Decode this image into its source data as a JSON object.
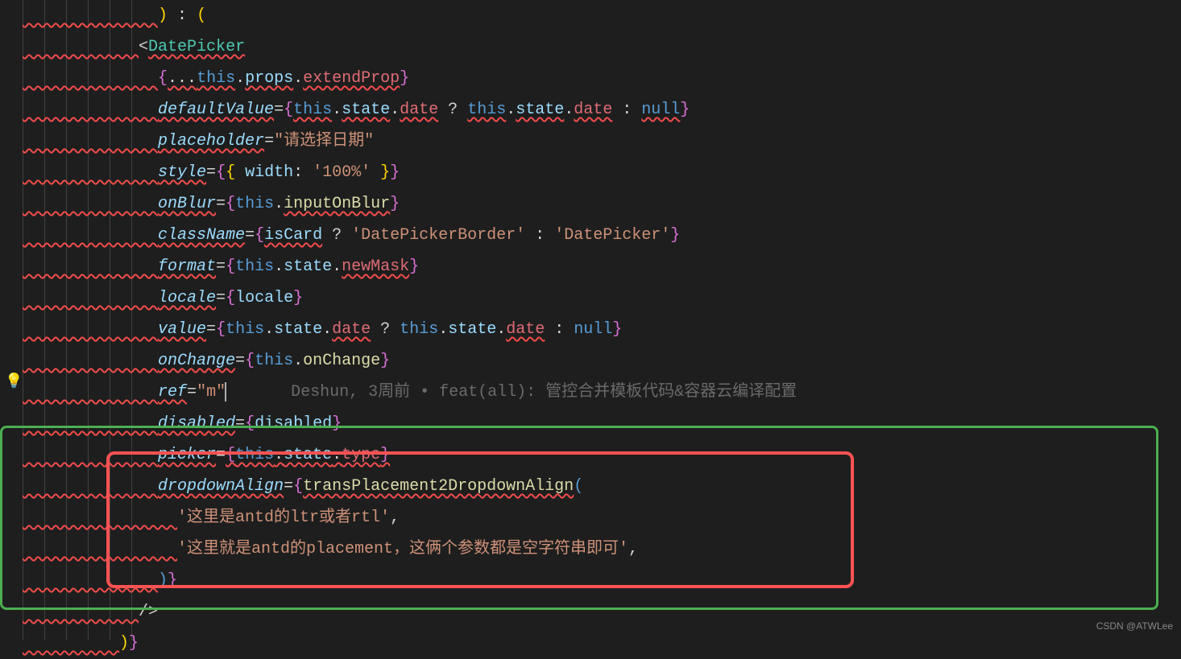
{
  "code": {
    "line0_indent": "              ",
    "line0_a": ")",
    "line0_b": " : ",
    "line0_c": "(",
    "line1_indent": "            ",
    "line1_open": "<",
    "line1_tag": "DatePicker",
    "prop_indent": "              ",
    "spread_open": "{",
    "spread_text": "...",
    "spread_this": "this",
    "spread_dot": ".",
    "spread_props": "props",
    "spread_extend": "extendProp",
    "spread_close": "}",
    "defaultValue": "defaultValue",
    "eq": "=",
    "this": "this",
    "dot": ".",
    "state": "state",
    "date": "date",
    "q": " ? ",
    "colon": " : ",
    "null": "null",
    "placeholder_attr": "placeholder",
    "placeholder_val": "\"请选择日期\"",
    "style_attr": "style",
    "style_open": "{{",
    "style_width": " width",
    "style_colon": ": ",
    "style_100": "'100%'",
    "style_close": " }}",
    "onBlur_attr": "onBlur",
    "onBlur_method": "inputOnBlur",
    "className_attr": "className",
    "isCard": "isCard",
    "dp_border": "'DatePickerBorder'",
    "dp": "'DatePicker'",
    "format_attr": "format",
    "newMask": "newMask",
    "locale_attr": "locale",
    "locale_val": "locale",
    "value_attr": "value",
    "onChange_attr": "onChange",
    "onChange_method": "onChange",
    "ref_attr": "ref",
    "ref_val": "\"m\"",
    "blame": "Deshun, 3周前 • feat(all): 管控合并模板代码&容器云编译配置",
    "disabled_attr": "disabled",
    "disabled_val": "disabled",
    "picker_attr": "picker",
    "type": "type",
    "dropdownAlign_attr": "dropdownAlign",
    "transPlacement": "transPlacement2DropdownAlign",
    "arg1": "'这里是antd的ltr或者rtl'",
    "arg2": "'这里就是antd的placement，这俩个参数都是空字符串即可'",
    "comma": ",",
    "close_paren": ")",
    "selfclose_indent": "            ",
    "selfclose": "/>",
    "end_indent": "          ",
    "end_a": ")",
    "end_b": "}"
  },
  "watermark": "CSDN @ATWLee"
}
